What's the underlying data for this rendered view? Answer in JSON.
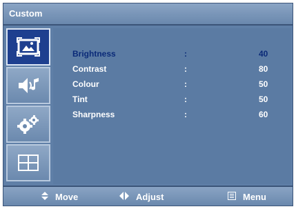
{
  "title": "Custom",
  "sidebar": {
    "tabs": [
      {
        "name": "picture-icon",
        "active": true
      },
      {
        "name": "sound-icon",
        "active": false
      },
      {
        "name": "settings-gears-icon",
        "active": false
      },
      {
        "name": "layout-grid-icon",
        "active": false
      }
    ]
  },
  "menu": {
    "items": [
      {
        "label": "Brightness",
        "separator": ":",
        "value": "40",
        "selected": true
      },
      {
        "label": "Contrast",
        "separator": ":",
        "value": "80",
        "selected": false
      },
      {
        "label": "Colour",
        "separator": ":",
        "value": "50",
        "selected": false
      },
      {
        "label": "Tint",
        "separator": ":",
        "value": "50",
        "selected": false
      },
      {
        "label": "Sharpness",
        "separator": ":",
        "value": "60",
        "selected": false
      }
    ]
  },
  "footer": {
    "move_label": "Move",
    "adjust_label": "Adjust",
    "menu_label": "Menu"
  },
  "colors": {
    "panel": "#5f7fa7",
    "selected_text": "#0a2a78",
    "active_tab": "#1e3f8f",
    "text": "#ffffff"
  }
}
